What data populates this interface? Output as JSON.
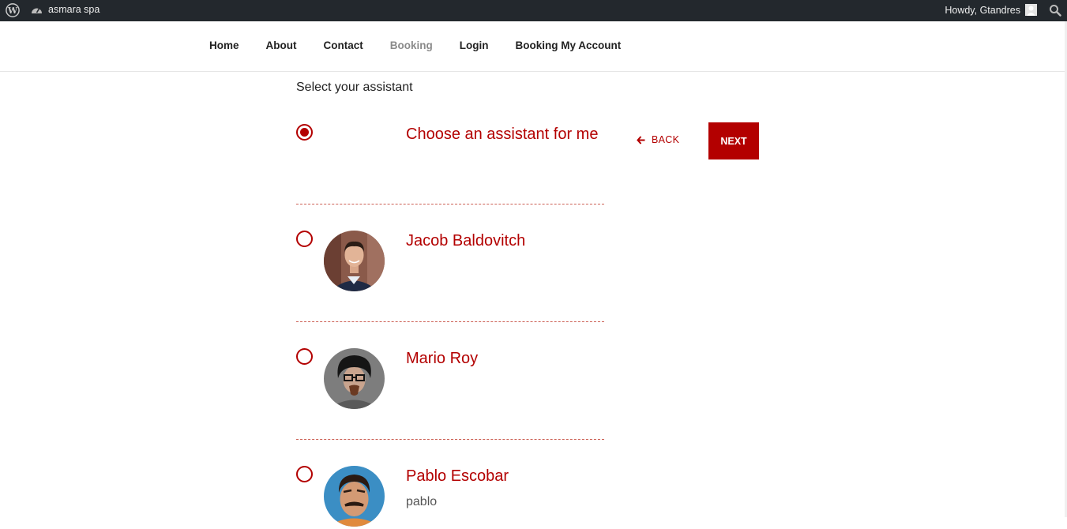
{
  "admin_bar": {
    "site_name": "asmara spa",
    "greeting": "Howdy, Gtandres"
  },
  "nav": {
    "items": [
      {
        "label": "Home"
      },
      {
        "label": "About"
      },
      {
        "label": "Contact"
      },
      {
        "label": "Booking"
      },
      {
        "label": "Login"
      },
      {
        "label": "Booking My Account"
      }
    ],
    "active": "Booking"
  },
  "booking": {
    "heading": "Select your assistant",
    "options": [
      {
        "name": "Choose an assistant for me",
        "selected": true
      },
      {
        "name": "Jacob Baldovitch",
        "selected": false
      },
      {
        "name": "Mario Roy",
        "selected": false
      },
      {
        "name": "Pablo Escobar",
        "description": "pablo",
        "selected": false
      }
    ],
    "back_label": "BACK",
    "next_label": "NEXT"
  },
  "colors": {
    "accent": "#b30000",
    "admin_bar": "#23282d"
  }
}
